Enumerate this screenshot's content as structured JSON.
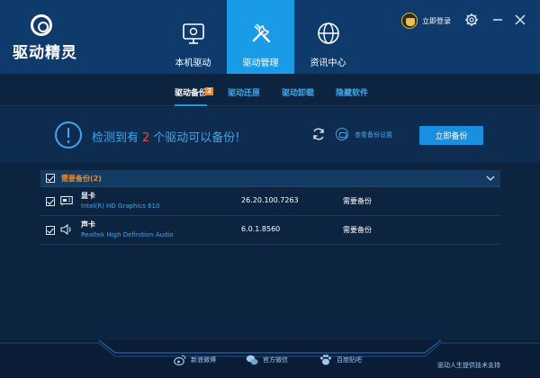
{
  "app": {
    "logo_text": "驱动精灵"
  },
  "header": {
    "nav": [
      {
        "label": "本机驱动",
        "icon": "monitor-icon"
      },
      {
        "label": "驱动管理",
        "icon": "tools-icon"
      },
      {
        "label": "资讯中心",
        "icon": "globe-icon"
      }
    ],
    "active_nav": 1,
    "login_text": "立即登录",
    "window_buttons": [
      "gear-icon",
      "minimize-icon",
      "close-icon"
    ]
  },
  "subtabs": {
    "items": [
      "驱动备份",
      "驱动还原",
      "驱动卸载",
      "隐藏软件"
    ],
    "active": 0,
    "backup_badge": "2"
  },
  "banner": {
    "message_prefix": "检测到有",
    "count": "2",
    "message_suffix": "个驱动可以备份!",
    "settings_link": "查看备份设置",
    "backup_button": "立即备份"
  },
  "list": {
    "group_label": "需要备份(2)",
    "group_checked": true,
    "drivers": [
      {
        "name": "显卡",
        "model": "Intel(R) HD Graphics 610",
        "version": "26.20.100.7263",
        "status": "需要备份",
        "icon": "display-card-icon",
        "checked": true
      },
      {
        "name": "声卡",
        "model": "Realtek High Definition Audio",
        "version": "6.0.1.8560",
        "status": "需要备份",
        "icon": "speaker-icon",
        "checked": true
      }
    ]
  },
  "footer": {
    "links": [
      {
        "label": "新浪微博",
        "icon": "weibo-icon"
      },
      {
        "label": "官方微信",
        "icon": "wechat-icon"
      },
      {
        "label": "百度贴吧",
        "icon": "tieba-icon"
      }
    ],
    "support_text": "驱动人生提供技术支持"
  },
  "colors": {
    "header_bg": "#0f3a6c",
    "accent": "#1a9be8",
    "warning": "#f08a24",
    "count_red": "#e84a3c",
    "body_bg": "#0c2440"
  }
}
